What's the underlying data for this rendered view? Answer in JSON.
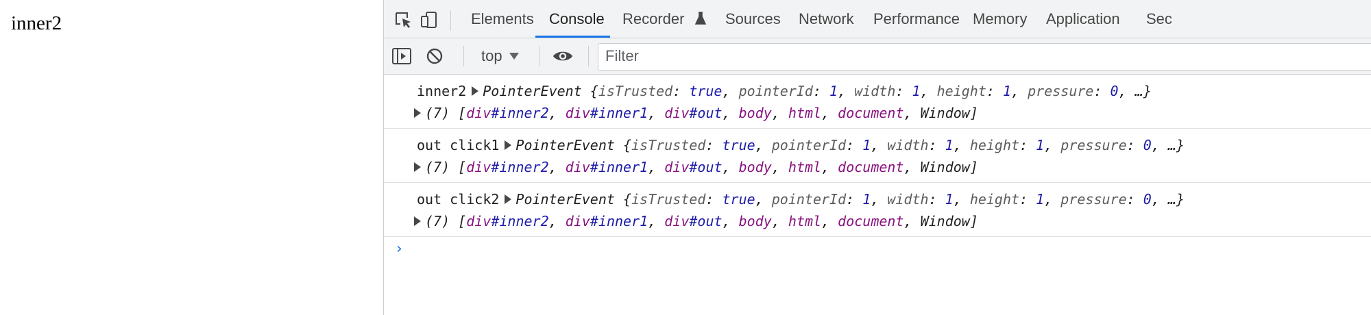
{
  "page": {
    "content_text": "inner2"
  },
  "devtools": {
    "tabs": [
      {
        "label": "Elements",
        "active": false
      },
      {
        "label": "Console",
        "active": true
      },
      {
        "label": "Recorder",
        "active": false
      },
      {
        "label": "Sources",
        "active": false
      },
      {
        "label": "Network",
        "active": false
      },
      {
        "label": "Performance",
        "active": false
      },
      {
        "label": "Memory",
        "active": false
      },
      {
        "label": "Application",
        "active": false
      },
      {
        "label": "Sec",
        "active": false
      }
    ],
    "accent": "#1a73e8",
    "toolbar": {
      "context": "top",
      "filter_placeholder": "Filter"
    },
    "console": {
      "entries": [
        {
          "label": "inner2",
          "event_type": "PointerEvent",
          "props": [
            {
              "k": "isTrusted",
              "v": "true"
            },
            {
              "k": "pointerId",
              "v": "1"
            },
            {
              "k": "width",
              "v": "1"
            },
            {
              "k": "height",
              "v": "1"
            },
            {
              "k": "pressure",
              "v": "0"
            }
          ],
          "path_count": "(7)",
          "path": [
            {
              "tag": "div",
              "id": "#inner2"
            },
            {
              "tag": "div",
              "id": "#inner1"
            },
            {
              "tag": "div",
              "id": "#out"
            },
            {
              "tag": "body",
              "id": ""
            },
            {
              "tag": "html",
              "id": ""
            },
            {
              "tag": "document",
              "id": ""
            },
            {
              "tag": "Window",
              "id": ""
            }
          ]
        },
        {
          "label": "out click1",
          "event_type": "PointerEvent",
          "props": [
            {
              "k": "isTrusted",
              "v": "true"
            },
            {
              "k": "pointerId",
              "v": "1"
            },
            {
              "k": "width",
              "v": "1"
            },
            {
              "k": "height",
              "v": "1"
            },
            {
              "k": "pressure",
              "v": "0"
            }
          ],
          "path_count": "(7)",
          "path": [
            {
              "tag": "div",
              "id": "#inner2"
            },
            {
              "tag": "div",
              "id": "#inner1"
            },
            {
              "tag": "div",
              "id": "#out"
            },
            {
              "tag": "body",
              "id": ""
            },
            {
              "tag": "html",
              "id": ""
            },
            {
              "tag": "document",
              "id": ""
            },
            {
              "tag": "Window",
              "id": ""
            }
          ]
        },
        {
          "label": "out click2",
          "event_type": "PointerEvent",
          "props": [
            {
              "k": "isTrusted",
              "v": "true"
            },
            {
              "k": "pointerId",
              "v": "1"
            },
            {
              "k": "width",
              "v": "1"
            },
            {
              "k": "height",
              "v": "1"
            },
            {
              "k": "pressure",
              "v": "0"
            }
          ],
          "path_count": "(7)",
          "path": [
            {
              "tag": "div",
              "id": "#inner2"
            },
            {
              "tag": "div",
              "id": "#inner1"
            },
            {
              "tag": "div",
              "id": "#out"
            },
            {
              "tag": "body",
              "id": ""
            },
            {
              "tag": "html",
              "id": ""
            },
            {
              "tag": "document",
              "id": ""
            },
            {
              "tag": "Window",
              "id": ""
            }
          ]
        }
      ],
      "prompt_symbol": "›"
    }
  }
}
